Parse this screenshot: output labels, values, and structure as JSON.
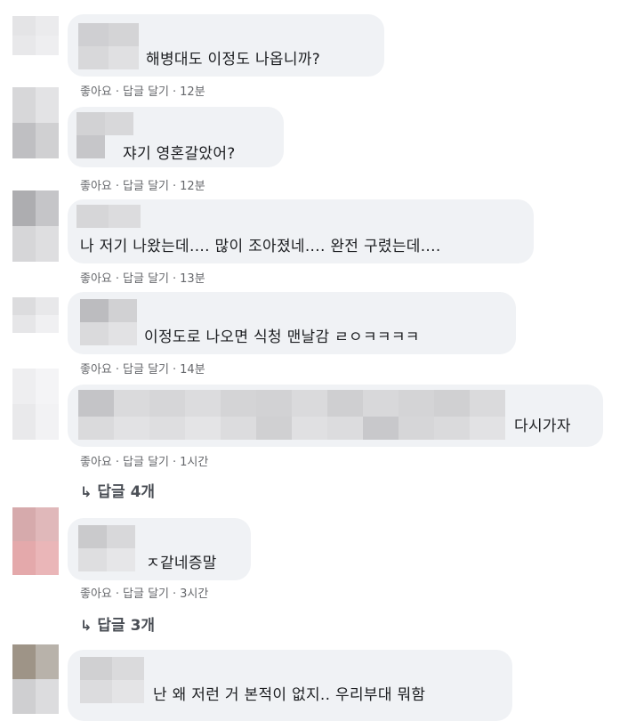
{
  "comments": [
    {
      "text": "해병대도 이정도 나옵니까?",
      "like": "좋아요",
      "reply": "답글 달기",
      "time": "12분"
    },
    {
      "text": "쟈기 영혼갈았어?",
      "like": "좋아요",
      "reply": "답글 달기",
      "time": "12분"
    },
    {
      "text": "나 저기 나왔는데.... 많이 조아졌네.... 완전 구렸는데....",
      "like": "좋아요",
      "reply": "답글 달기",
      "time": "13분"
    },
    {
      "text": "이정도로 나오면 식청 맨날감 ㄹㅇㅋㅋㅋㅋ",
      "like": "좋아요",
      "reply": "답글 달기",
      "time": "14분"
    },
    {
      "text": "다시가자",
      "like": "좋아요",
      "reply": "답글 달기",
      "time": "1시간",
      "replies": "답글 4개"
    },
    {
      "text": "ㅈ같네증말",
      "like": "좋아요",
      "reply": "답글 달기",
      "time": "3시간",
      "replies": "답글 3개"
    },
    {
      "text": "난 왜 저런 거 본적이 없지.. 우리부대 뭐함"
    }
  ],
  "reply_arrow_icon": "reply-arrow-icon",
  "colors": {
    "bubble": "#f0f2f5",
    "meta": "#65676b",
    "text": "#1c1e21"
  }
}
